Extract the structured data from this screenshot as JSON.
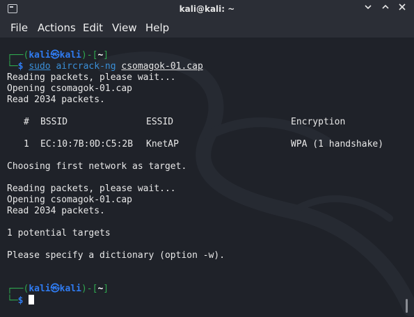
{
  "window": {
    "title": "kali@kali: ~"
  },
  "menu": [
    {
      "label": "File"
    },
    {
      "label": "Actions"
    },
    {
      "label": "Edit"
    },
    {
      "label": "View"
    },
    {
      "label": "Help"
    }
  ],
  "prompt": {
    "open": "┌──(",
    "user": "kali",
    "at": "㉿",
    "host": "kali",
    "close": ")-[",
    "dir": "~",
    "end": "]",
    "corner": "└─",
    "dollar": "$"
  },
  "command": {
    "sudo": "sudo",
    "program": "aircrack-ng",
    "arg": "csomagok-01.cap"
  },
  "output": {
    "reading1": "Reading packets, please wait...",
    "opening1": "Opening csomagok-01.cap",
    "read1": "Read 2034 packets.",
    "table_headers": {
      "num": "#",
      "bssid": "BSSID",
      "essid": "ESSID",
      "encryption": "Encryption"
    },
    "table_rows": [
      {
        "num": "1",
        "bssid": "EC:10:7B:0D:C5:2B",
        "essid": "KnetAP",
        "encryption": "WPA (1 handshake)"
      }
    ],
    "choosing": "Choosing first network as target.",
    "reading2": "Reading packets, please wait...",
    "opening2": "Opening csomagok-01.cap",
    "read2": "Read 2034 packets.",
    "targets": "1 potential targets",
    "dictionary": "Please specify a dictionary (option -w)."
  },
  "colors": {
    "background": "#1f2229",
    "prompt_blue": "#2f7bf0",
    "prompt_green": "#2fa84f"
  }
}
